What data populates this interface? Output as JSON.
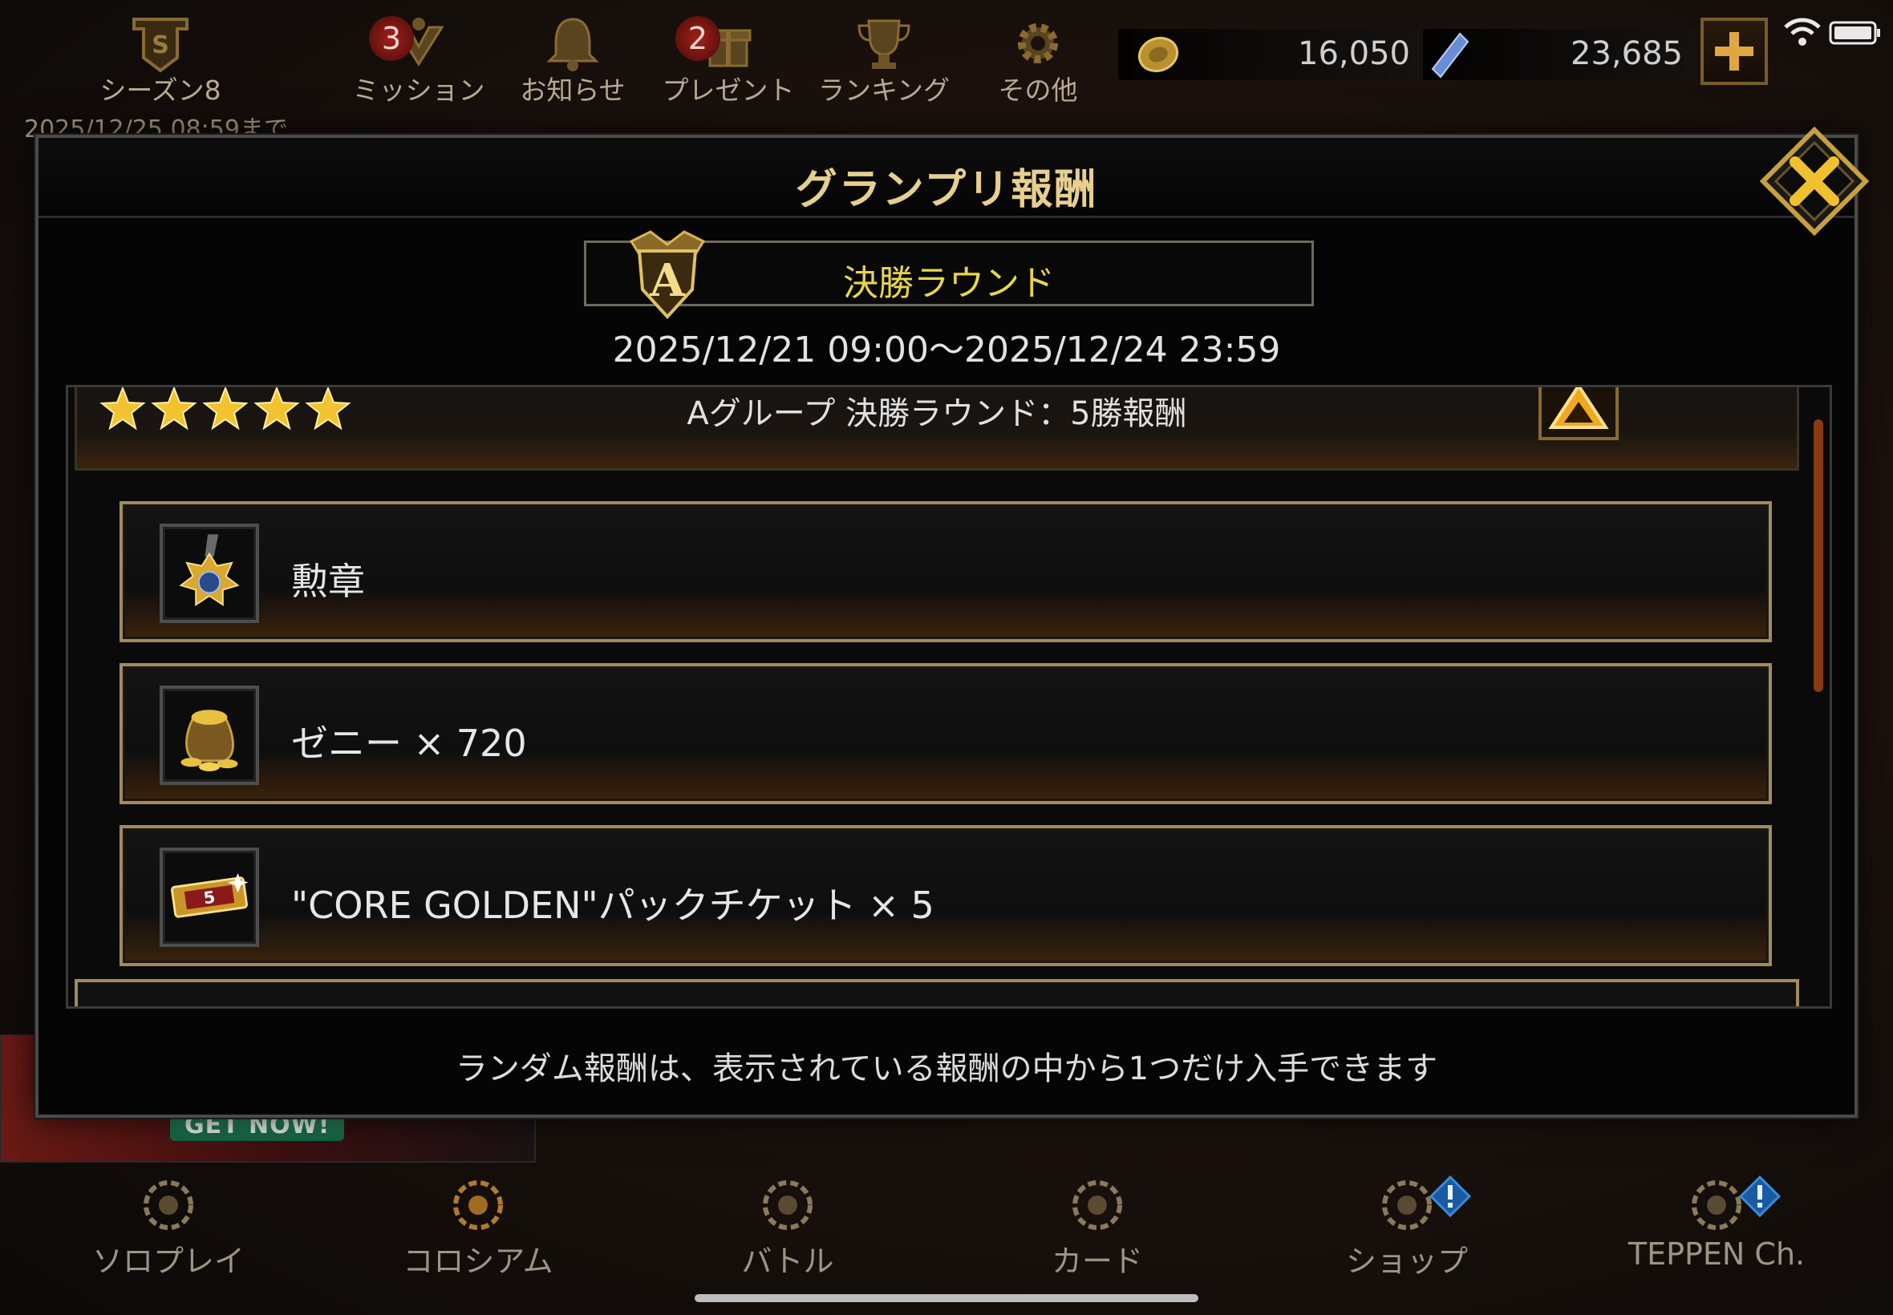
{
  "top_bar": {
    "season": {
      "label": "シーズン8",
      "date": "2025/12/25 08:59まで"
    },
    "items": [
      {
        "label": "ミッション",
        "badge": "3"
      },
      {
        "label": "お知らせ",
        "badge": ""
      },
      {
        "label": "プレゼント",
        "badge": "2"
      },
      {
        "label": "ランキング",
        "badge": ""
      },
      {
        "label": "その他",
        "badge": ""
      }
    ],
    "currencies": {
      "zenny": "16,050",
      "gems": "23,685"
    }
  },
  "dialog": {
    "title": "グランプリ報酬",
    "round_label": "決勝ラウンド",
    "round_emblem_letter": "A",
    "period": "2025/12/21 09:00〜2025/12/24 23:59",
    "group_title": "Aグループ 決勝ラウンド：5勝報酬",
    "stars": 5,
    "rewards": [
      {
        "icon": "medal-icon",
        "text": "勲章"
      },
      {
        "icon": "zenny-bag-icon",
        "text": "ゼニー × 720"
      },
      {
        "icon": "pack-ticket-icon",
        "text": "\"CORE GOLDEN\"パックチケット × 5",
        "ticket_number": "5"
      }
    ],
    "footnote": "ランダム報酬は、表示されている報酬の中から1つだけ入手できます"
  },
  "banner": {
    "label": "GET NOW!"
  },
  "bottom_nav": [
    {
      "label": "ソロプレイ"
    },
    {
      "label": "コロシアム"
    },
    {
      "label": "バトル"
    },
    {
      "label": "カード"
    },
    {
      "label": "ショップ"
    },
    {
      "label": "TEPPEN Ch."
    }
  ],
  "colors": {
    "title_gold": "#e6cf8f",
    "round_yellow": "#e9d64a",
    "row_border": "#a08a62",
    "badge_red": "#a4211a"
  }
}
